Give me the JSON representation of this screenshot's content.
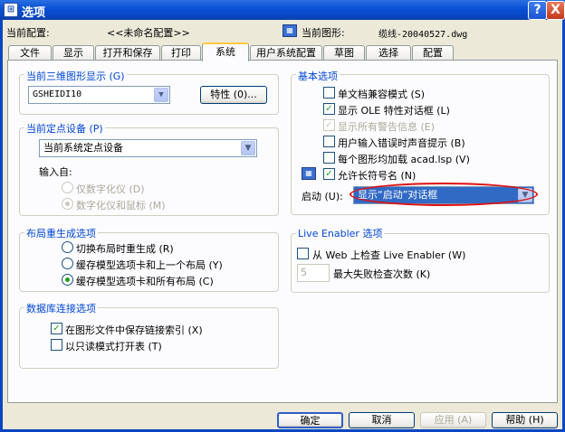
{
  "window": {
    "title": "选项",
    "help_glyph": "?",
    "close_glyph": "X"
  },
  "profile": {
    "label": "当前配置:",
    "value": "<<未命名配置>>",
    "drawing_label": "当前图形:",
    "drawing_value": "缆线-20040527.dwg"
  },
  "tabs": [
    {
      "label": "文件"
    },
    {
      "label": "显示"
    },
    {
      "label": "打开和保存"
    },
    {
      "label": "打印"
    },
    {
      "label": "系统",
      "active": true
    },
    {
      "label": "用户系统配置"
    },
    {
      "label": "草图"
    },
    {
      "label": "选择"
    },
    {
      "label": "配置"
    }
  ],
  "display3d": {
    "title": "当前三维图形显示 (G)",
    "value": "GSHEIDI10",
    "properties_button": "特性 (0)..."
  },
  "pointing": {
    "title": "当前定点设备 (P)",
    "value": "当前系统定点设备",
    "accept_label": "输入自:",
    "options": [
      {
        "label": "仅数字化仪 (D)",
        "selected": false
      },
      {
        "label": "数字化仪和鼠标 (M)",
        "selected": true
      }
    ]
  },
  "layout_regen": {
    "title": "布局重生成选项",
    "options": [
      {
        "label": "切换布局时重生成 (R)",
        "selected": false
      },
      {
        "label": "缓存模型选项卡和上一个布局 (Y)",
        "selected": false
      },
      {
        "label": "缓存模型选项卡和所有布局 (C)",
        "selected": true
      }
    ]
  },
  "dbconnect": {
    "title": "数据库连接选项",
    "options": [
      {
        "label": "在图形文件中保存链接索引 (X)",
        "checked": true
      },
      {
        "label": "以只读模式打开表 (T)",
        "checked": false
      }
    ]
  },
  "general": {
    "title": "基本选项",
    "options": [
      {
        "label": "单文档兼容模式 (S)",
        "checked": false
      },
      {
        "label": "显示 OLE 特性对话框 (L)",
        "checked": true
      },
      {
        "label": "显示所有警告信息 (E)",
        "checked": true,
        "disabled": true
      },
      {
        "label": "用户输入错误时声音提示 (B)",
        "checked": false
      },
      {
        "label": "每个图形均加载 acad.lsp (V)",
        "checked": false
      },
      {
        "label": "允许长符号名 (N)",
        "checked": true
      }
    ],
    "startup_label": "启动 (U):",
    "startup_value": "显示“启动”对话框"
  },
  "live_enabler": {
    "title": "Live Enabler 选项",
    "check_label": "从 Web 上检查 Live Enabler (W)",
    "checked": false,
    "attempts_value": "5",
    "attempts_label": "最大失败检查次数 (K)"
  },
  "buttons": {
    "ok": "确定",
    "cancel": "取消",
    "apply": "应用 (A)",
    "help": "帮助 (H)"
  },
  "glyphs": {
    "check": "✓",
    "arrow_down": "▼"
  },
  "colors": {
    "group_title": "#0046d5",
    "title_bar": "#0a52d6",
    "selection": "#316ac5",
    "annotation_ellipse": "#e01010"
  }
}
